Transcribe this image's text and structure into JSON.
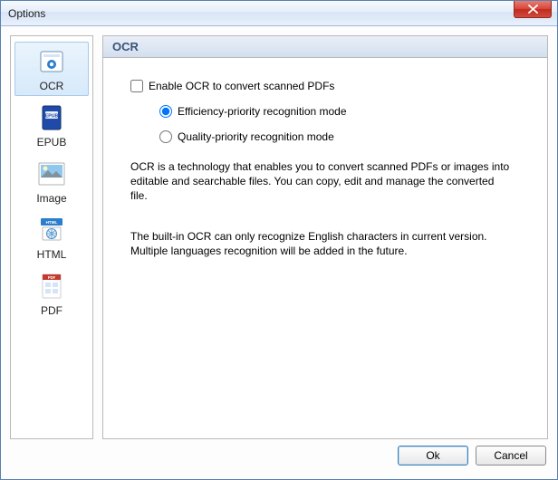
{
  "window": {
    "title": "Options"
  },
  "sidebar": {
    "items": [
      {
        "label": "OCR"
      },
      {
        "label": "EPUB"
      },
      {
        "label": "Image"
      },
      {
        "label": "HTML"
      },
      {
        "label": "PDF"
      }
    ]
  },
  "main": {
    "heading": "OCR",
    "enable_label": "Enable OCR to convert scanned PDFs",
    "radio_efficiency": "Efficiency-priority recognition mode",
    "radio_quality": "Quality-priority recognition mode",
    "desc1": "OCR is a technology that enables you to convert scanned PDFs or images into editable and searchable files. You can copy, edit and manage the converted file.",
    "desc2": "The built-in OCR can only recognize English characters in current version. Multiple languages recognition will be added in the future."
  },
  "footer": {
    "ok": "Ok",
    "cancel": "Cancel"
  }
}
